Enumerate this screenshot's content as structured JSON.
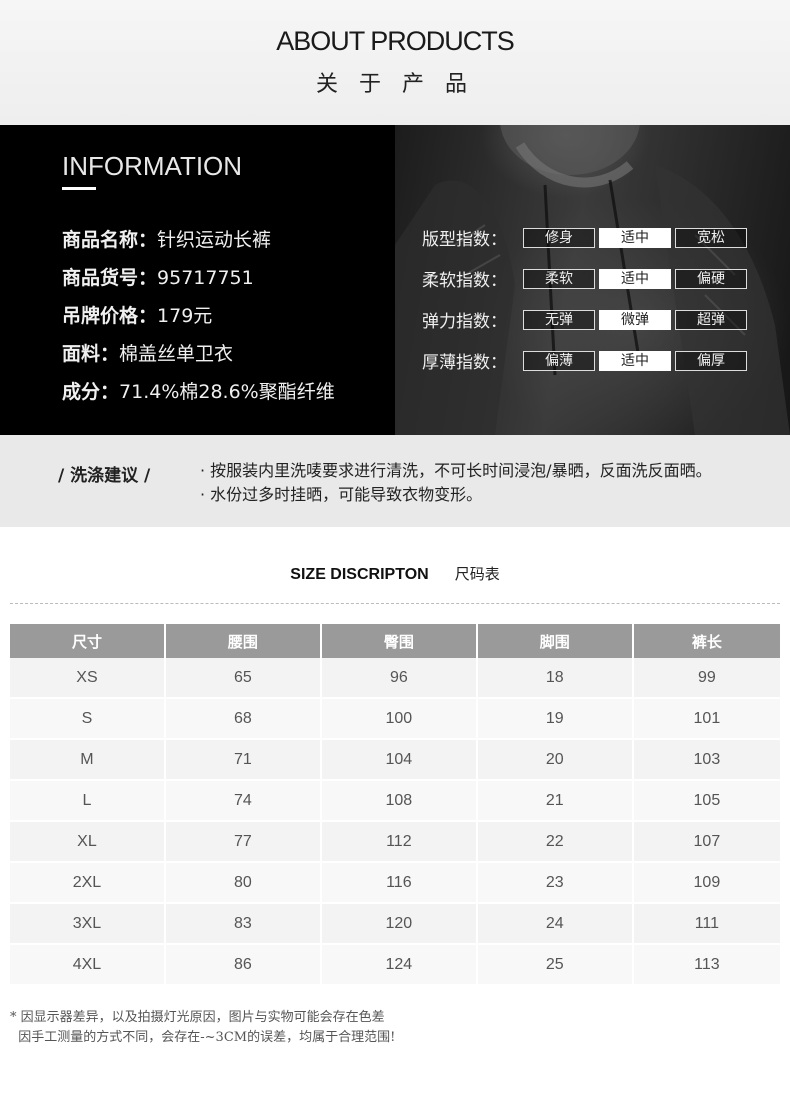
{
  "header": {
    "title_en": "ABOUT PRODUCTS",
    "title_cn": "关 于 产 品"
  },
  "info": {
    "title": "INFORMATION",
    "specs": [
      {
        "key": "商品名称：",
        "value": "针织运动长裤"
      },
      {
        "key": "商品货号：",
        "value": "95717751"
      },
      {
        "key": "吊牌价格：",
        "value": "179元"
      },
      {
        "key": "面料：",
        "value": "棉盖丝单卫衣"
      },
      {
        "key": "成分：",
        "value": "71.4%棉28.6%聚酯纤维"
      }
    ],
    "ratings": [
      {
        "label": "版型指数：",
        "options": [
          "修身",
          "适中",
          "宽松"
        ],
        "selected": 1
      },
      {
        "label": "柔软指数：",
        "options": [
          "柔软",
          "适中",
          "偏硬"
        ],
        "selected": 1
      },
      {
        "label": "弹力指数：",
        "options": [
          "无弹",
          "微弹",
          "超弹"
        ],
        "selected": 1
      },
      {
        "label": "厚薄指数：",
        "options": [
          "偏薄",
          "适中",
          "偏厚"
        ],
        "selected": 1
      }
    ]
  },
  "wash": {
    "heading": "/ 洗涤建议 /",
    "lines": [
      "· 按服装内里洗唛要求进行清洗，不可长时间浸泡/暴晒，反面洗反面晒。",
      "· 水份过多时挂晒，可能导致衣物变形。"
    ]
  },
  "size": {
    "title_en": "SIZE DISCRIPTON",
    "title_cn": "尺码表",
    "headers": [
      "尺寸",
      "腰围",
      "臀围",
      "脚围",
      "裤长"
    ],
    "rows": [
      [
        "XS",
        "65",
        "96",
        "18",
        "99"
      ],
      [
        "S",
        "68",
        "100",
        "19",
        "101"
      ],
      [
        "M",
        "71",
        "104",
        "20",
        "103"
      ],
      [
        "L",
        "74",
        "108",
        "21",
        "105"
      ],
      [
        "XL",
        "77",
        "112",
        "22",
        "107"
      ],
      [
        "2XL",
        "80",
        "116",
        "23",
        "109"
      ],
      [
        "3XL",
        "83",
        "120",
        "24",
        "111"
      ],
      [
        "4XL",
        "86",
        "124",
        "25",
        "113"
      ]
    ]
  },
  "note": [
    "* 因显示器差异，以及拍摄灯光原因，图片与实物可能会存在色差",
    "  因手工测量的方式不同，会存在-~3CM的误差，均属于合理范围!"
  ],
  "colors": {
    "header_bg": "#efefef",
    "info_bg": "#000000",
    "wash_bg": "#e9e9e9",
    "table_header": "#9a9a9a"
  }
}
